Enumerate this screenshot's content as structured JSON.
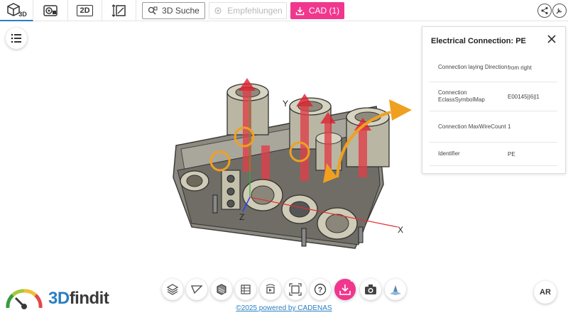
{
  "header": {
    "modes": [
      {
        "label": "3D",
        "icon": "cube-3d-icon"
      },
      {
        "label": "",
        "icon": "gallery-icon"
      },
      {
        "label": "2D",
        "icon": "2d-icon"
      },
      {
        "label": "",
        "icon": "dimension-icon"
      }
    ],
    "search_label": "3D Suche",
    "recommend_label": "Empfehlungen",
    "cad_label": "CAD (1)",
    "accent_color": "#f0378d"
  },
  "viewer": {
    "axis_x": "X",
    "axis_y": "Y",
    "axis_z": "Z"
  },
  "panel": {
    "title": "Electrical Connection: PE",
    "properties": [
      {
        "key": "Connection laying Direction",
        "value": "from right"
      },
      {
        "key": "Connection EclassSymbolMap",
        "value": "E00145||6||1"
      },
      {
        "key": "Connection MaxWireCount",
        "value": "1"
      },
      {
        "key": "Identifier",
        "value": "PE"
      }
    ]
  },
  "toolbar": {
    "tools": [
      "hatch-icon",
      "measure-icon",
      "section-icon",
      "bom-icon",
      "animation-icon",
      "fit-view-icon",
      "help-icon",
      "download-icon",
      "camera-icon",
      "light-icon"
    ],
    "download_badge": "(1)"
  },
  "brand": {
    "logo_prefix": "3D",
    "logo_suffix": "findit"
  },
  "footer": {
    "text": "©2025 powered by CADENAS"
  },
  "ar_label": "AR"
}
